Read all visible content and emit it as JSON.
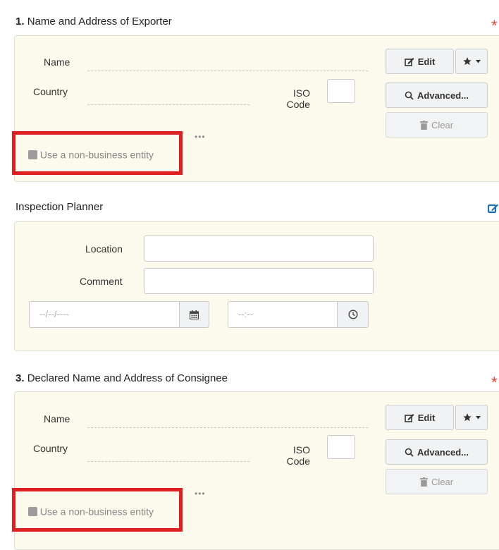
{
  "section1": {
    "number": "1.",
    "title": "Name and Address of Exporter",
    "required_mark": "*",
    "name_label": "Name",
    "country_label": "Country",
    "iso_label_line1": "ISO",
    "iso_label_line2": "Code",
    "edit_label": "Edit",
    "advanced_label": "Advanced...",
    "clear_label": "Clear",
    "more": "•••",
    "non_business_label": "Use a non-business entity"
  },
  "inspection": {
    "title": "Inspection Planner",
    "location_label": "Location",
    "comment_label": "Comment",
    "date_placeholder": "--/--/----",
    "time_placeholder": "--:--"
  },
  "section3": {
    "number": "3.",
    "title": "Declared Name and Address of Consignee",
    "required_mark": "*",
    "name_label": "Name",
    "country_label": "Country",
    "iso_label_line1": "ISO",
    "iso_label_line2": "Code",
    "edit_label": "Edit",
    "advanced_label": "Advanced...",
    "clear_label": "Clear",
    "more": "•••",
    "non_business_label": "Use a non-business entity"
  },
  "icons": [
    "edit-icon",
    "star-icon",
    "caret-down-icon",
    "search-icon",
    "trash-icon",
    "calendar-icon",
    "clock-icon",
    "pencil-square-icon"
  ],
  "colors": {
    "required": "#e8412f",
    "highlight_box": "#e02020",
    "panel_bg": "#fcfaed",
    "edit_accent": "#1b6fb5"
  }
}
